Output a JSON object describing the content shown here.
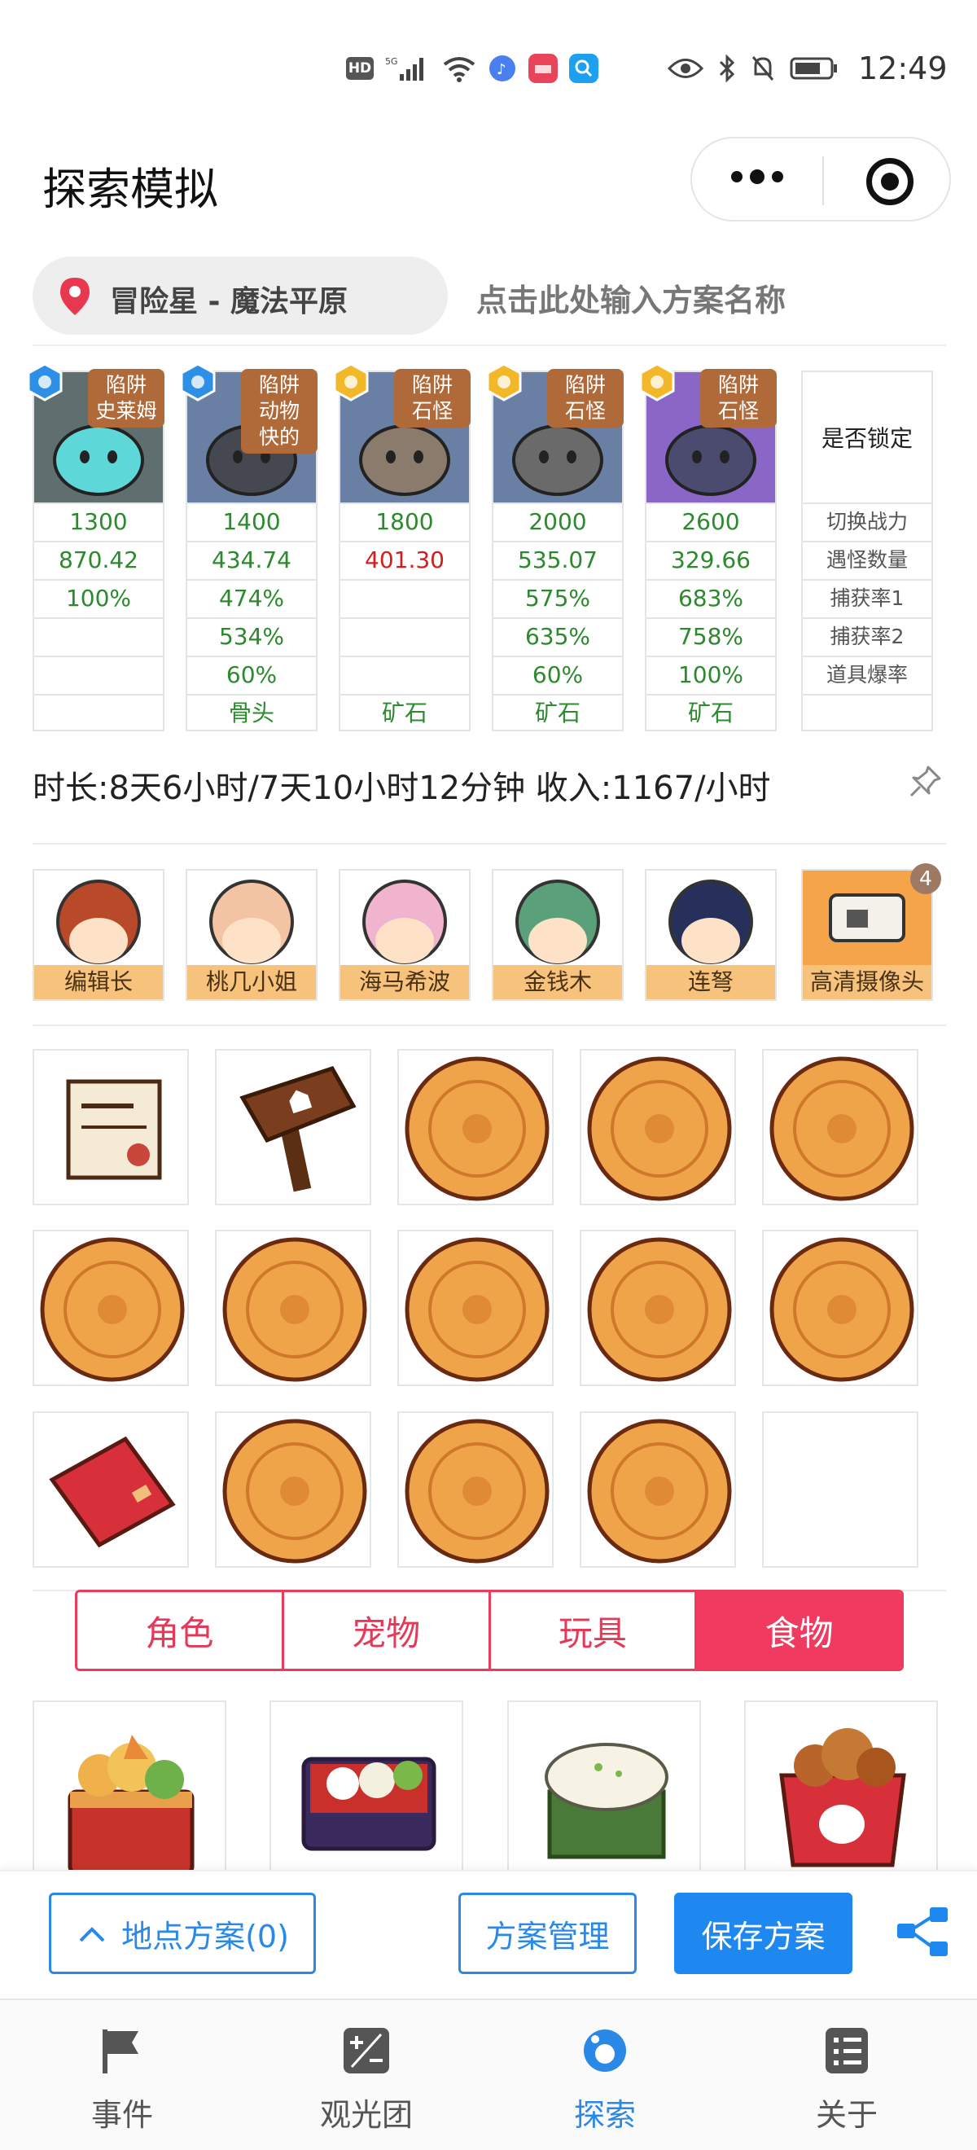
{
  "status_bar": {
    "hd": "HD",
    "time": "12:49"
  },
  "header": {
    "title": "探索模拟"
  },
  "location": {
    "label": "冒险星 - 魔法平原",
    "plan_name_placeholder": "点击此处输入方案名称"
  },
  "monsters": [
    {
      "trap": "陷阱\n史莱姆",
      "rank": "blue-hexagon-icon",
      "power": "1300",
      "count": "870.42",
      "rate1": "100%",
      "rate2": "",
      "drop": "",
      "item": ""
    },
    {
      "trap": "陷阱\n动物\n快的",
      "rank": "blue-hexagon-icon",
      "power": "1400",
      "count": "434.74",
      "rate1": "474%",
      "rate2": "534%",
      "drop": "60%",
      "item": "骨头"
    },
    {
      "trap": "陷阱\n石怪",
      "rank": "gold-hexagon-icon",
      "power": "1800",
      "count": "401.30",
      "rate1": "",
      "rate2": "",
      "drop": "",
      "item": "矿石"
    },
    {
      "trap": "陷阱\n石怪",
      "rank": "gold-hexagon-icon",
      "power": "2000",
      "count": "535.07",
      "rate1": "575%",
      "rate2": "635%",
      "drop": "60%",
      "item": "矿石"
    },
    {
      "trap": "陷阱\n石怪",
      "rank": "gold-hexagon-icon",
      "power": "2600",
      "count": "329.66",
      "rate1": "683%",
      "rate2": "758%",
      "drop": "100%",
      "item": "矿石"
    }
  ],
  "lock_column": {
    "header": "是否锁定",
    "rows": [
      "切换战力",
      "遇怪数量",
      "捕获率1",
      "捕获率2",
      "道具爆率"
    ]
  },
  "duration_text": "时长:8天6小时/7天10小时12分钟 收入:1167/小时",
  "team": [
    {
      "label": "编辑长"
    },
    {
      "label": "桃几小姐"
    },
    {
      "label": "海马希波"
    },
    {
      "label": "金钱木"
    },
    {
      "label": "连弩"
    },
    {
      "label": "高清摄像头",
      "badge": "4"
    }
  ],
  "items_grid": [
    "document-icon",
    "signpost-icon",
    "mooncake-icon",
    "mooncake-icon",
    "mooncake-icon",
    "mooncake-icon",
    "mooncake-icon",
    "mooncake-icon",
    "mooncake-icon",
    "mooncake-icon",
    "red-book-icon",
    "mooncake-icon",
    "mooncake-icon",
    "mooncake-icon",
    ""
  ],
  "category_tabs": [
    "角色",
    "宠物",
    "玩具",
    "食物"
  ],
  "active_tab": "食物",
  "foods": [
    "bento-tempura-icon",
    "bento-box-icon",
    "rice-cake-icon",
    "fried-chicken-bucket-icon"
  ],
  "actions": {
    "location_plan": "地点方案(0)",
    "plan_manage": "方案管理",
    "save_plan": "保存方案"
  },
  "tabbar": [
    {
      "label": "事件",
      "icon": "flag-icon"
    },
    {
      "label": "观光团",
      "icon": "plus-minus-icon"
    },
    {
      "label": "探索",
      "icon": "planet-icon"
    },
    {
      "label": "关于",
      "icon": "list-icon"
    }
  ],
  "colors": {
    "accent_blue": "#1e88f0",
    "tab_red": "#f03a5f",
    "green_value": "#2b8a2b",
    "red_value": "#d21e1e",
    "label_orange": "#f7c27b"
  }
}
